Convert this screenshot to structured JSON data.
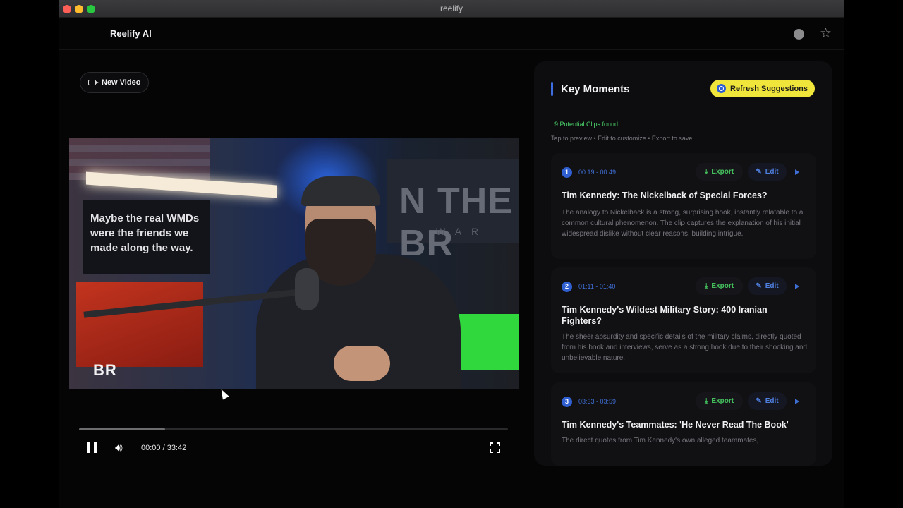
{
  "window": {
    "title": "reelify"
  },
  "app": {
    "name": "Reelify AI"
  },
  "toolbar": {
    "new_video_label": "New Video"
  },
  "video": {
    "overlay_text": "Maybe the real WMDs were the friends we made along the way.",
    "wall_text": "N THE BR",
    "wall_subtext": "WAR",
    "logo_text": "BR",
    "time_display": "00:00 / 33:42",
    "progress_fraction": 0.2
  },
  "panel": {
    "title": "Key Moments",
    "refresh_label": "Refresh Suggestions",
    "found_text": "9 Potential Clips found",
    "hint_text": "Tap to preview • Edit to customize • Export to save",
    "export_label": "Export",
    "edit_label": "Edit",
    "clips": [
      {
        "number": "1",
        "time": "00:19 - 00:49",
        "title": "Tim Kennedy: The Nickelback of Special Forces?",
        "description": "The analogy to Nickelback is a strong, surprising hook, instantly relatable to a common cultural phenomenon. The clip captures the explanation of his initial widespread dislike without clear reasons, building intrigue."
      },
      {
        "number": "2",
        "time": "01:11 - 01:40",
        "title": "Tim Kennedy's Wildest Military Story: 400 Iranian Fighters?",
        "description": "The sheer absurdity and specific details of the military claims, directly quoted from his book and interviews, serve as a strong hook due to their shocking and unbelievable nature."
      },
      {
        "number": "3",
        "time": "03:33 - 03:59",
        "title": "Tim Kennedy's Teammates: 'He Never Read The Book'",
        "description": "The direct quotes from Tim Kennedy's own alleged teammates,"
      }
    ]
  },
  "colors": {
    "accent_blue": "#2f5fd0",
    "highlight_yellow": "#f0e53a",
    "success_green": "#4cd36a"
  },
  "icons": [
    "camera-icon",
    "star-icon",
    "pause-icon",
    "volume-icon",
    "fullscreen-icon",
    "refresh-icon",
    "download-icon",
    "pencil-icon",
    "play-icon"
  ]
}
